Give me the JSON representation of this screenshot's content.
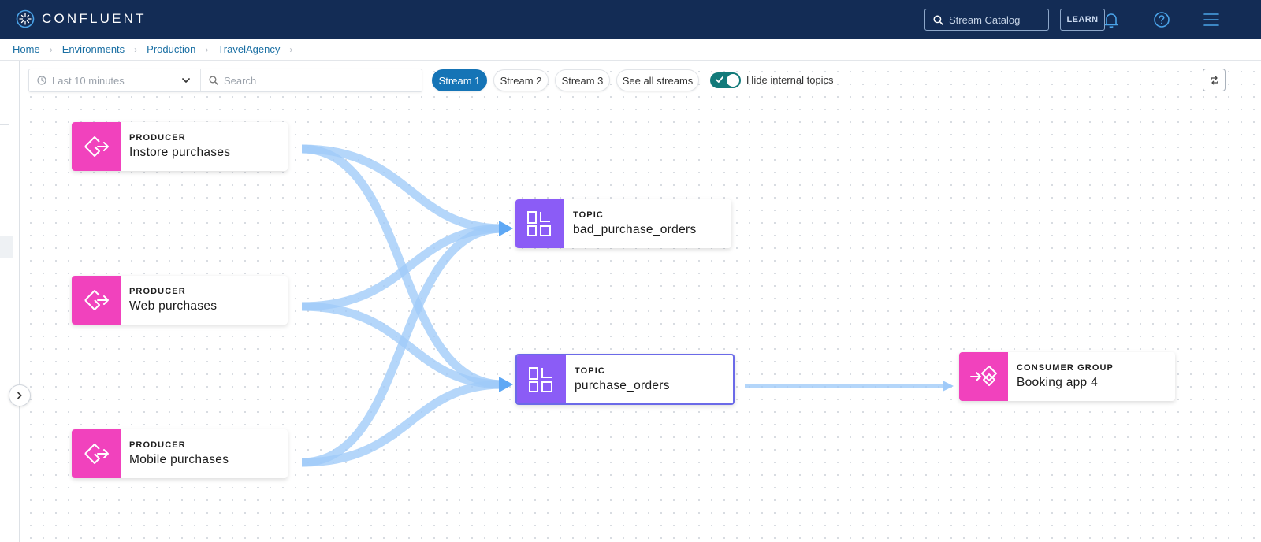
{
  "brand": {
    "name": "CONFLUENT"
  },
  "header": {
    "catalog_placeholder": "Stream Catalog",
    "learn_label": "LEARN",
    "icons": [
      "bell-icon",
      "help-icon",
      "menu-icon"
    ]
  },
  "breadcrumb": [
    "Home",
    "Environments",
    "Production",
    "TravelAgency"
  ],
  "toolbar": {
    "time_range": "Last 10 minutes",
    "search_placeholder": "Search",
    "streams": [
      "Stream 1",
      "Stream 2",
      "Stream 3"
    ],
    "active_stream": "Stream 1",
    "see_all_label": "See all streams",
    "hide_internal_label": "Hide internal topics",
    "hide_internal_enabled": true
  },
  "nodes": {
    "producer_instore": {
      "kind": "PRODUCER",
      "name": "Instore purchases"
    },
    "producer_web": {
      "kind": "PRODUCER",
      "name": "Web purchases"
    },
    "producer_mobile": {
      "kind": "PRODUCER",
      "name": "Mobile purchases"
    },
    "topic_bad": {
      "kind": "TOPIC",
      "name": "bad_purchase_orders"
    },
    "topic_purchase": {
      "kind": "TOPIC",
      "name": "purchase_orders",
      "selected": true
    },
    "consumer_booking": {
      "kind": "CONSUMER GROUP",
      "name": "Booking app 4"
    }
  },
  "colors": {
    "topbar": "#132c55",
    "producer": "#f142bd",
    "topic": "#8b5cf6",
    "consumer": "#f142bd",
    "flow": "#9fcaf9",
    "flow_arrow": "#5ea8f5",
    "accent": "#1574b6",
    "toggle": "#127a7a"
  }
}
